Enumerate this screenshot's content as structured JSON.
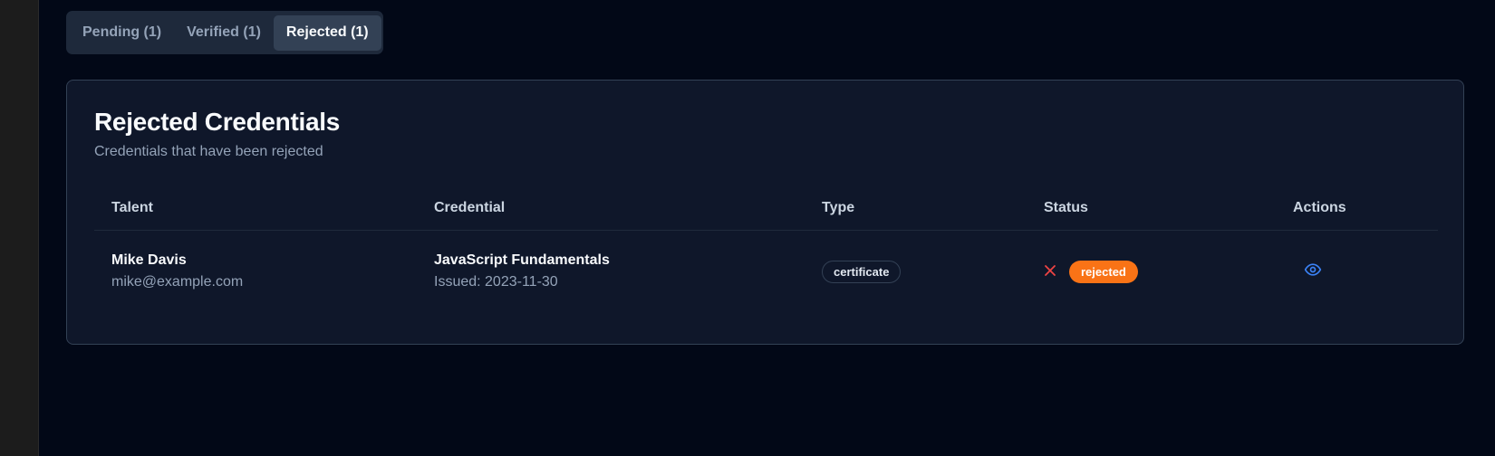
{
  "tabs": [
    {
      "label": "Pending (1)",
      "active": false
    },
    {
      "label": "Verified (1)",
      "active": false
    },
    {
      "label": "Rejected (1)",
      "active": true
    }
  ],
  "card": {
    "title": "Rejected Credentials",
    "subtitle": "Credentials that have been rejected"
  },
  "table": {
    "headers": {
      "talent": "Talent",
      "credential": "Credential",
      "type": "Type",
      "status": "Status",
      "actions": "Actions"
    },
    "rows": [
      {
        "name": "Mike Davis",
        "email": "mike@example.com",
        "credential": "JavaScript Fundamentals",
        "issued": "Issued: 2023-11-30",
        "type": "certificate",
        "status": "rejected",
        "status_icon": "x-icon",
        "action_icon": "eye-icon"
      }
    ]
  },
  "colors": {
    "background": "#020817",
    "card": "#0f172a",
    "status_rejected": "#f97316",
    "reject_icon": "#ef4444",
    "view_icon": "#3b82f6"
  }
}
